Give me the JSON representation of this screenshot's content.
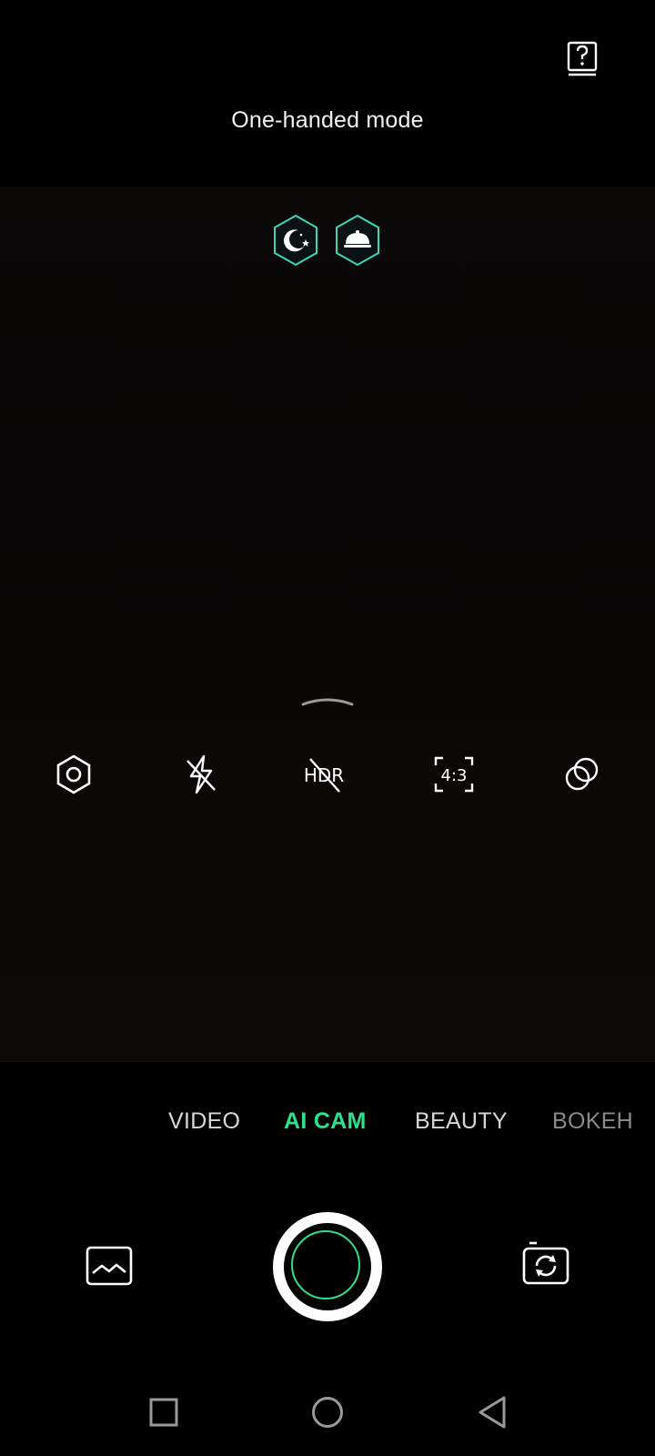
{
  "header": {
    "title": "One-handed mode",
    "help_icon": "help-book-icon"
  },
  "viewfinder": {
    "scene_badges": [
      {
        "icon": "night-scene-icon"
      },
      {
        "icon": "food-scene-icon"
      }
    ],
    "quick_settings": [
      {
        "icon": "settings-hexagon-icon"
      },
      {
        "icon": "flash-off-icon"
      },
      {
        "icon": "hdr-off-icon",
        "text": "HDR"
      },
      {
        "icon": "aspect-ratio-icon",
        "text": "4:3"
      },
      {
        "icon": "filter-icon"
      }
    ]
  },
  "modes": {
    "items": [
      "VIDEO",
      "AI CAM",
      "BEAUTY",
      "BOKEH"
    ],
    "selected": "AI CAM"
  },
  "colors": {
    "accent": "#2fe08a",
    "badge_border": "#3fd6b8",
    "background": "#000000"
  },
  "controls": {
    "gallery_icon": "gallery-icon",
    "shutter": "shutter-button",
    "switch_icon": "switch-camera-icon"
  },
  "nav": {
    "items": [
      "recents-icon",
      "home-icon",
      "back-icon"
    ]
  }
}
